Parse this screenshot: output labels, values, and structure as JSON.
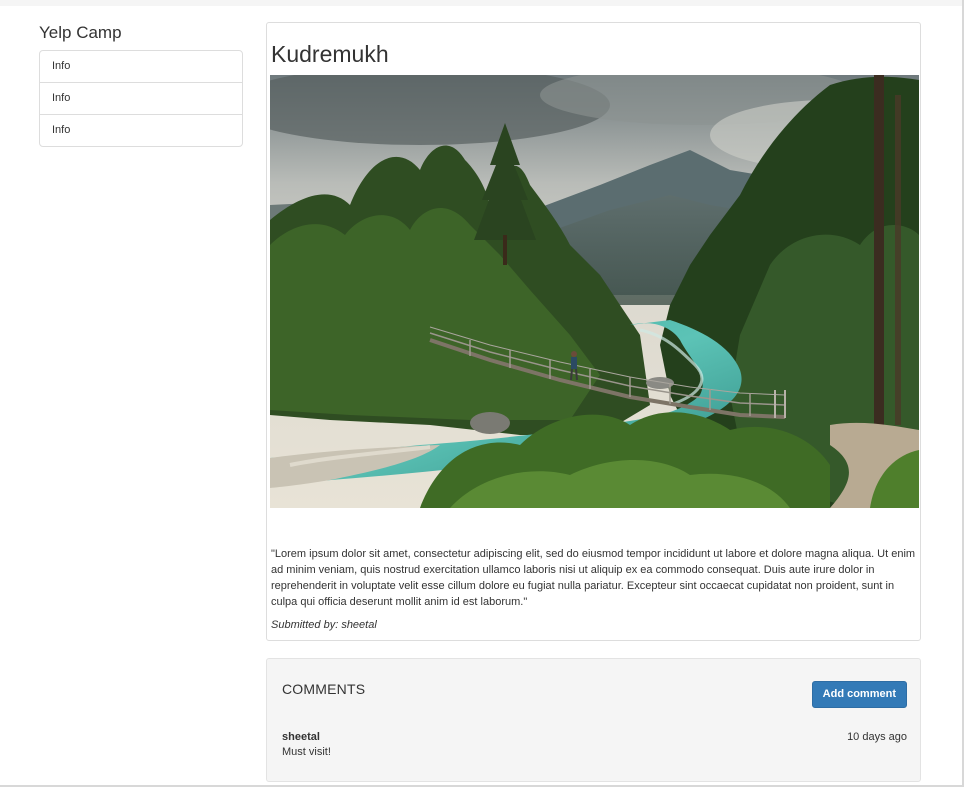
{
  "sidebar": {
    "brand": "Yelp Camp",
    "items": [
      {
        "label": "Info"
      },
      {
        "label": "Info"
      },
      {
        "label": "Info"
      }
    ]
  },
  "campground": {
    "name": "Kudremukh",
    "image_alt": "Kudremukh",
    "description": "\"Lorem ipsum dolor sit amet, consectetur adipiscing elit, sed do eiusmod tempor incididunt ut labore et dolore magna aliqua. Ut enim ad minim veniam, quis nostrud exercitation ullamco laboris nisi ut aliquip ex ea commodo consequat. Duis aute irure dolor in reprehenderit in voluptate velit esse cillum dolore eu fugiat nulla pariatur. Excepteur sint occaecat cupidatat non proident, sunt in culpa qui officia deserunt mollit anim id est laborum.\"",
    "submitted_by": "Submitted by: sheetal"
  },
  "comments": {
    "heading": "COMMENTS",
    "add_label": "Add comment",
    "items": [
      {
        "author": "sheetal",
        "time": "10 days ago",
        "text": "Must visit!"
      }
    ]
  },
  "colors": {
    "primary_button": "#337ab7",
    "well_background": "#f5f5f5",
    "border": "#dddddd"
  }
}
